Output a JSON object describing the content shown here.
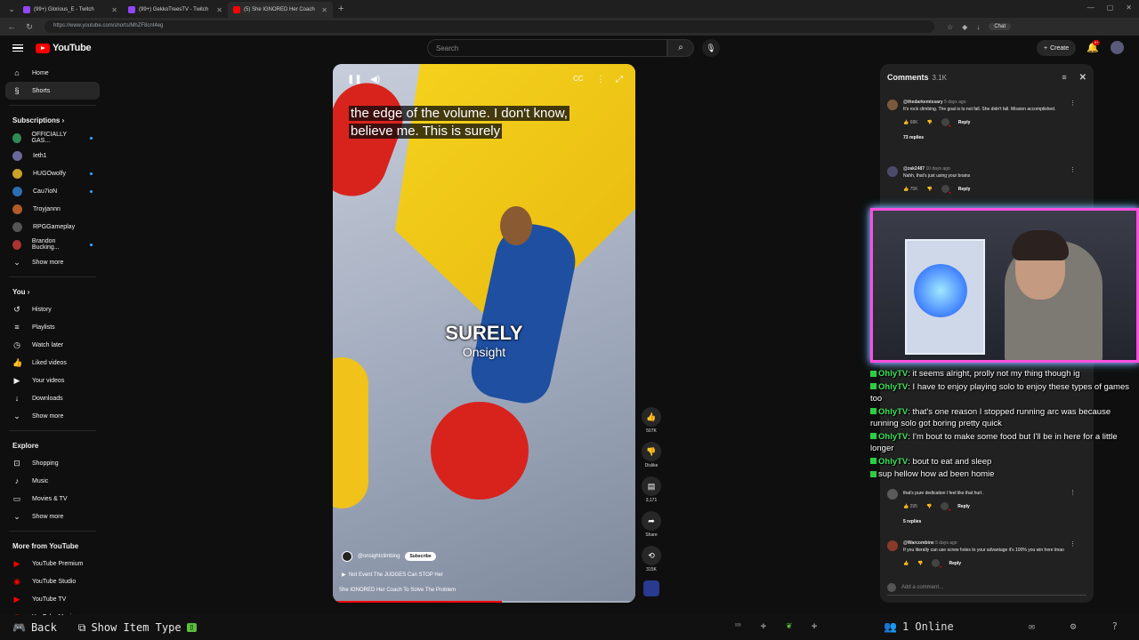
{
  "browser": {
    "tabs": [
      {
        "label": "(99+) Glorious_E - Twitch",
        "color": "#9146ff",
        "active": false
      },
      {
        "label": "(99+) GekkoTreesTV - Twitch",
        "color": "#9146ff",
        "active": false
      },
      {
        "label": "(5) She IGNORED Her Coach",
        "color": "#ff0000",
        "active": true
      }
    ],
    "url": "https://www.youtube.com/shorts/MhZF8cnt4eg",
    "chat_label": "Chat"
  },
  "header": {
    "logo_text": "YouTube",
    "search_placeholder": "Search",
    "create_label": "Create",
    "notification_count": "9+"
  },
  "sidebar": {
    "main": [
      {
        "label": "Home",
        "icon": "home-icon",
        "glyph": "⌂"
      },
      {
        "label": "Shorts",
        "icon": "shorts-icon",
        "glyph": "§"
      }
    ],
    "subscriptions_title": "Subscriptions",
    "subscriptions": [
      {
        "label": "OFFICIALLY GAS...",
        "color": "#2e8b57",
        "live": true
      },
      {
        "label": "Ieth1",
        "color": "#6a6a9a",
        "live": false
      },
      {
        "label": "HUGOwolfy",
        "color": "#c9a227",
        "live": true
      },
      {
        "label": "Cau7ioN",
        "color": "#2a6fb0",
        "live": true
      },
      {
        "label": "Troyjannn",
        "color": "#b35a2a",
        "live": false
      },
      {
        "label": "RPGGameplay",
        "color": "#555555",
        "live": false
      },
      {
        "label": "Brandon Bucking...",
        "color": "#a33",
        "live": true
      }
    ],
    "show_more": "Show more",
    "you_title": "You",
    "you_items": [
      {
        "label": "History",
        "icon": "history-icon",
        "glyph": "↺"
      },
      {
        "label": "Playlists",
        "icon": "playlists-icon",
        "glyph": "≡"
      },
      {
        "label": "Watch later",
        "icon": "watch-later-icon",
        "glyph": "◷"
      },
      {
        "label": "Liked videos",
        "icon": "liked-icon",
        "glyph": "👍"
      },
      {
        "label": "Your videos",
        "icon": "your-videos-icon",
        "glyph": "▶"
      },
      {
        "label": "Downloads",
        "icon": "downloads-icon",
        "glyph": "↓"
      }
    ],
    "show_more_2": "Show more",
    "explore_title": "Explore",
    "explore_items": [
      {
        "label": "Shopping",
        "icon": "shopping-icon",
        "glyph": "⊡"
      },
      {
        "label": "Music",
        "icon": "music-icon",
        "glyph": "♪"
      },
      {
        "label": "Movies & TV",
        "icon": "movies-icon",
        "glyph": "▭"
      }
    ],
    "show_more_3": "Show more",
    "more_title": "More from YouTube",
    "more_items": [
      {
        "label": "YouTube Premium",
        "glyph": "▶"
      },
      {
        "label": "YouTube Studio",
        "glyph": "◉"
      },
      {
        "label": "YouTube TV",
        "glyph": "▶"
      },
      {
        "label": "YouTube Music",
        "glyph": "◉"
      }
    ]
  },
  "short": {
    "caption_line1": "the edge of the volume. I don't know,",
    "caption_line2": "believe me. This is surely",
    "overlay_big": "SURELY",
    "overlay_sub": "Onsight",
    "channel": "@onsightclimbing",
    "subscribe": "Subscribe",
    "subtitle": "Not Event The JUDGES Can STOP Her",
    "title": "She IGNORED Her Coach To Solve The Problem",
    "progress": 0.56
  },
  "actions": {
    "like_count": "507K",
    "dislike_label": "Dislike",
    "comment_count": "3,171",
    "share_label": "Share",
    "remix_count": "315K"
  },
  "comments": {
    "title": "Comments",
    "count": "3.1K",
    "items": [
      {
        "user": "@thedarkemissary",
        "time": "5 days ago",
        "text": "It's rock climbing. The goal is to not fall. She didn't fall. Mission accomplished.",
        "likes": "68K",
        "replies": "73 replies",
        "avatar": "#7a5a3a"
      },
      {
        "user": "@zak2487",
        "time": "10 days ago",
        "text": "Nahh, that's just using your brains",
        "likes": "75K",
        "replies": "",
        "avatar": "#4a4a6a"
      },
      {
        "user": "",
        "time": "",
        "text": "that's pure dedication I feel like that hurt .",
        "likes": "295",
        "replies": "5 replies",
        "avatar": "#5a5a5a"
      },
      {
        "user": "@Warcombine",
        "time": "5 days ago",
        "text": "If you literally can use screw holes to your advantage it's 100% you win here lmao",
        "likes": "",
        "replies": "",
        "avatar": "#8a3a2a"
      }
    ],
    "reply_label": "Reply",
    "add_placeholder": "Add a comment..."
  },
  "stream_chat": [
    {
      "user": "OhlyTV",
      "text": ": it seems alright, prolly not my thing though ig"
    },
    {
      "user": "OhlyTV",
      "text": ": I have to enjoy playing solo to enjoy these types of games too"
    },
    {
      "user": "OhlyTV",
      "text": ": that's one reason I stopped running arc was because running solo got boring pretty quick"
    },
    {
      "user": "OhlyTV",
      "text": ": I'm bout to make some food but I'll be in here for a little longer"
    },
    {
      "user": "OhlyTV",
      "text": ": bout to eat and sleep"
    },
    {
      "user": "",
      "text": "sup hellow how ad been homie"
    }
  ],
  "bottom_bar": {
    "back": "Back",
    "item_type": "Show Item Type",
    "online": "1 Online"
  }
}
